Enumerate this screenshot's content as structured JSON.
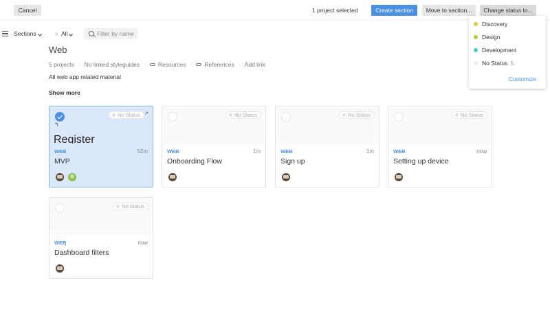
{
  "topbar": {
    "cancel_label": "Cancel",
    "selection_text": "1 project selected",
    "create_section_label": "Create section",
    "move_to_section_label": "Move to section...",
    "change_status_label": "Change status to..."
  },
  "toolbar": {
    "sections_label": "Sections",
    "all_label": "All",
    "filter_placeholder": "Filter by name",
    "filter_value": ""
  },
  "section": {
    "title": "Web",
    "projects_count": "5 projects",
    "styleguides": "No linked styleguides",
    "resources": "Resources",
    "references": "References",
    "add_link": "Add link",
    "description": "All web app related material",
    "show_more": "Show more"
  },
  "cards": [
    {
      "label": "WEB",
      "time": "52m",
      "name": "MVP",
      "status": "No Status",
      "thumb_text": "Register",
      "selected": true
    },
    {
      "label": "WEB",
      "time": "1m",
      "name": "Onboarding Flow",
      "status": "No Status",
      "selected": false
    },
    {
      "label": "WEB",
      "time": "1m",
      "name": "Sign up",
      "status": "No Status",
      "selected": false
    },
    {
      "label": "WEB",
      "time": "now",
      "name": "Setting up device",
      "status": "No Status",
      "selected": false
    },
    {
      "label": "WEB",
      "time": "now",
      "name": "Dashboard filters",
      "status": "No Status",
      "selected": false
    }
  ],
  "status_menu": {
    "items": [
      {
        "label": "Discovery",
        "color": "#e8c93a",
        "count": ""
      },
      {
        "label": "Design",
        "color": "#b5cc3a",
        "count": ""
      },
      {
        "label": "Development",
        "color": "#4cc6c6",
        "count": ""
      },
      {
        "label": "No Status",
        "color": "#e8e8e8",
        "count": "5"
      }
    ],
    "customize_label": "Customize"
  },
  "colors": {
    "accent": "#4a90e2",
    "selected_card_bg": "#dbe8fb"
  }
}
